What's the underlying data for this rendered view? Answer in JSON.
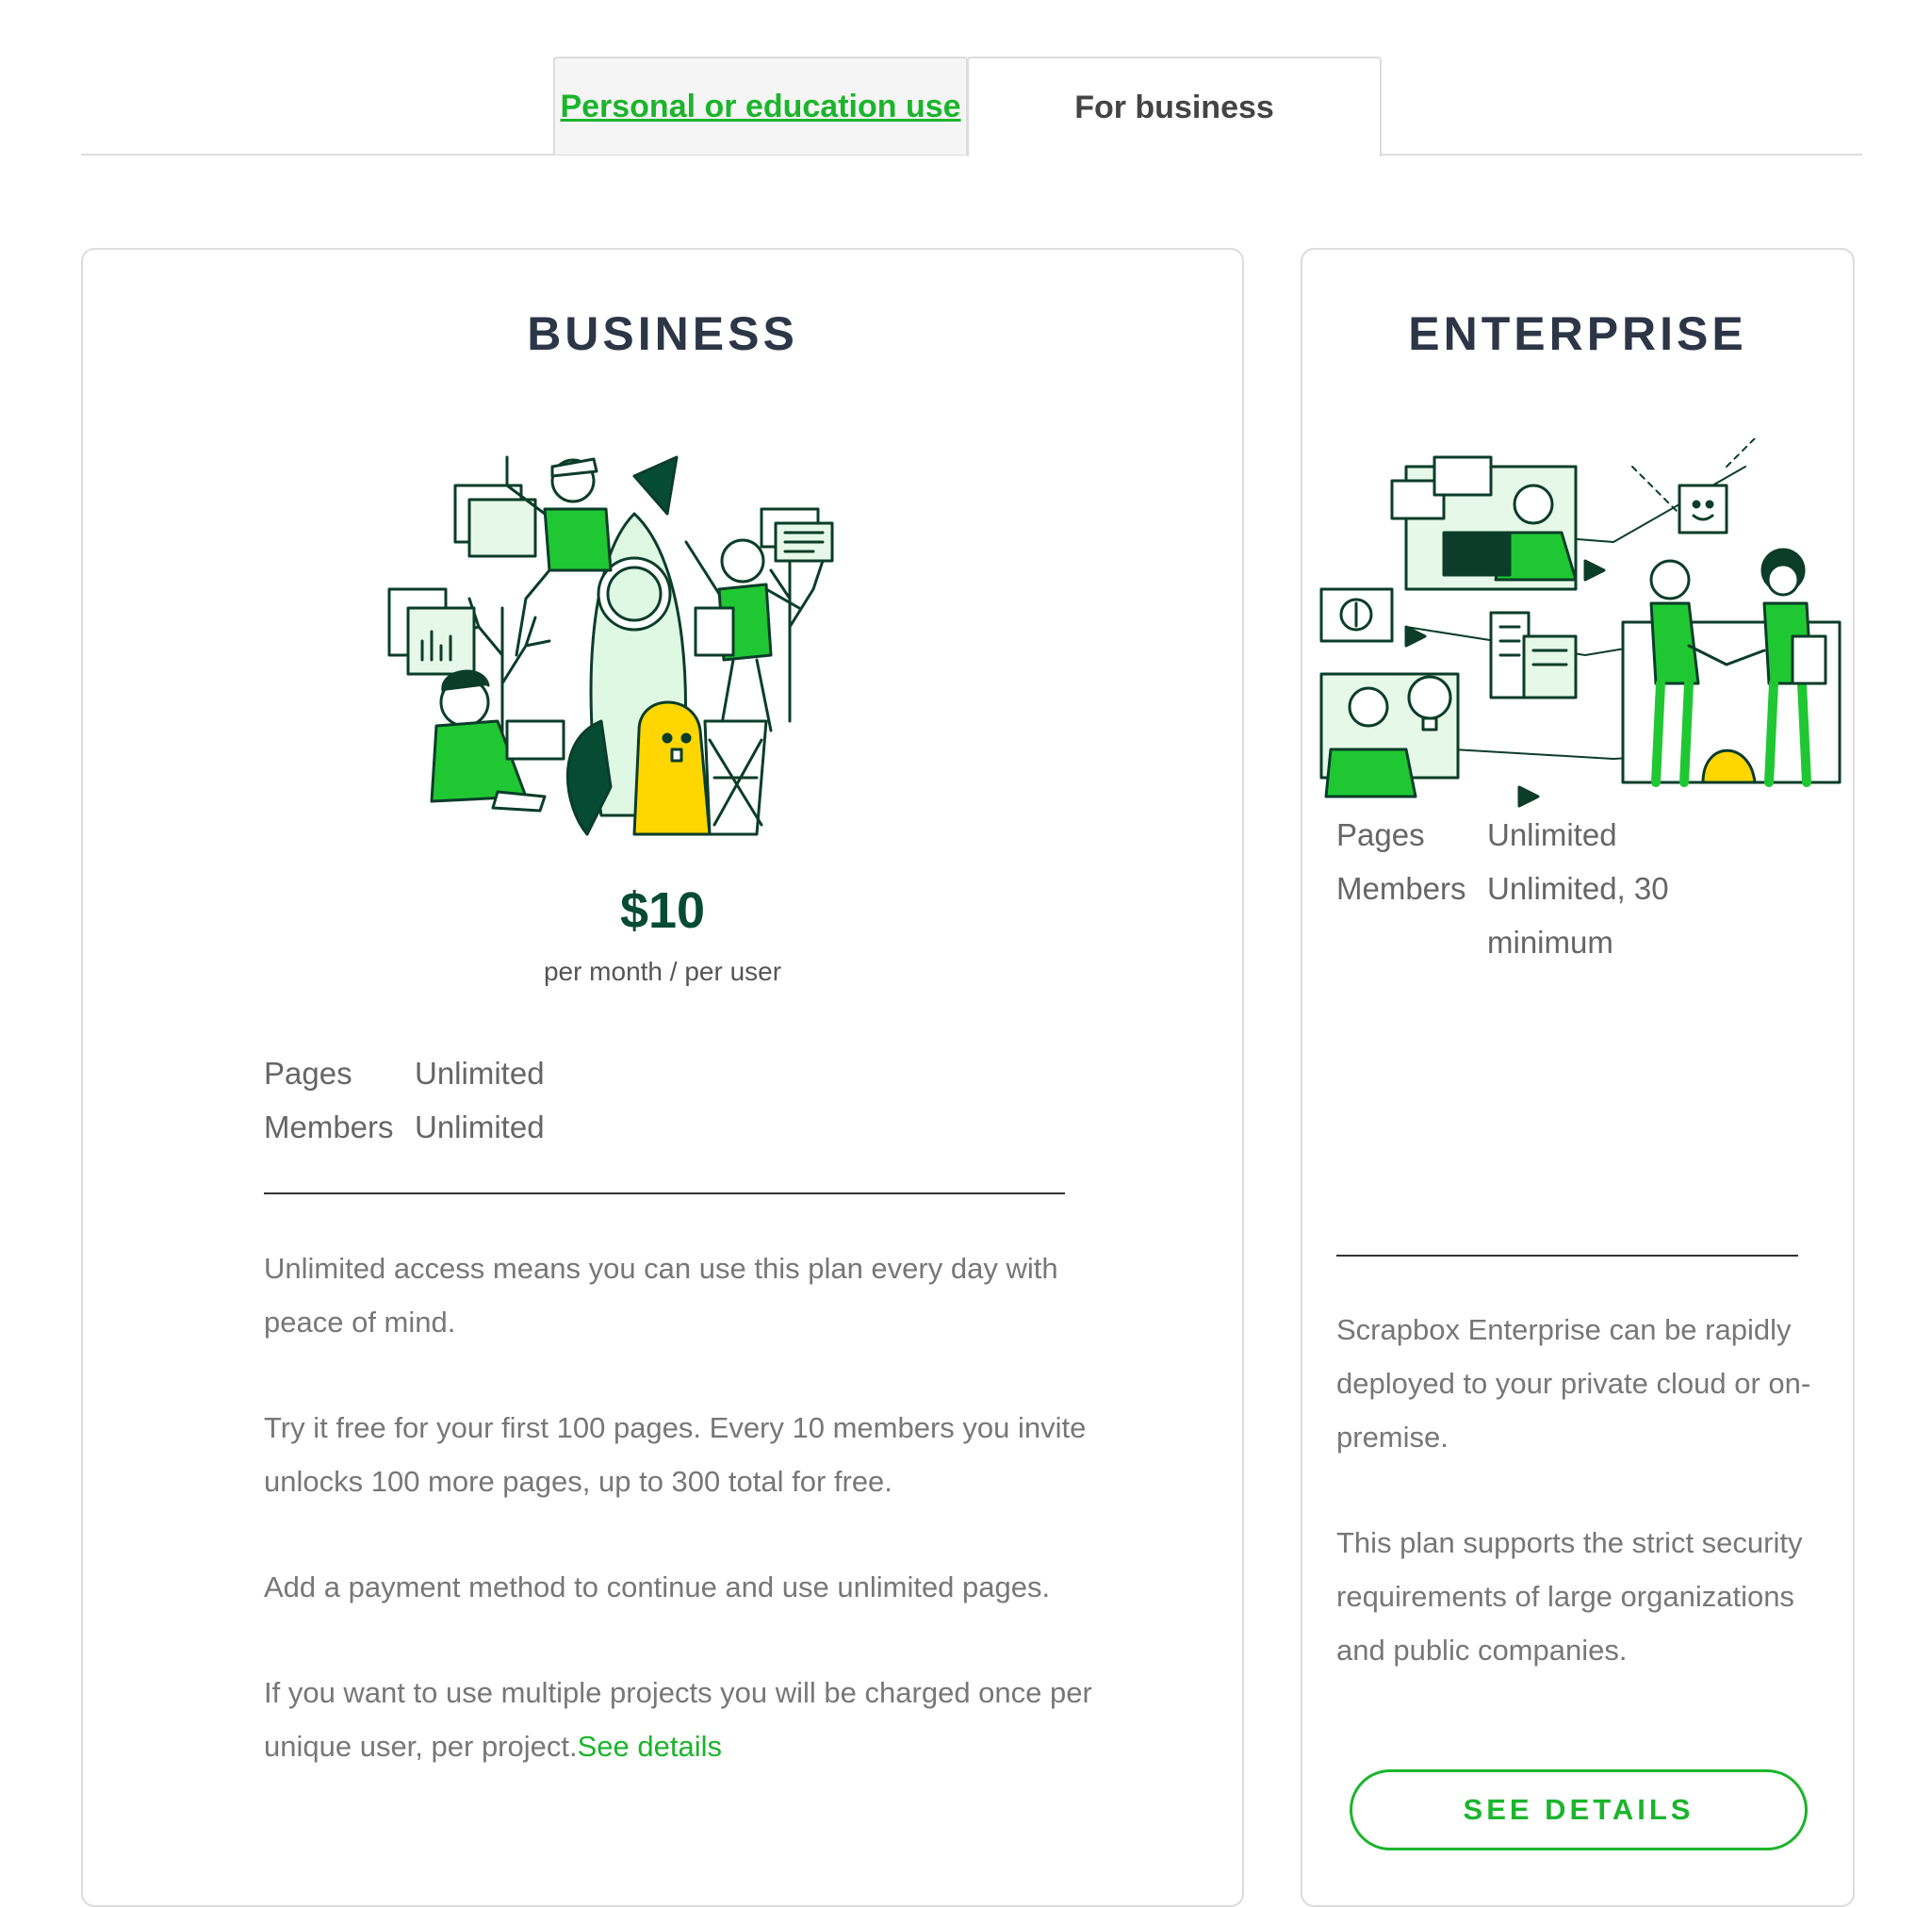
{
  "tabs": {
    "personal_label": "Personal or education use",
    "business_label": "For business"
  },
  "business": {
    "title": "BUSINESS",
    "price": "$10",
    "price_unit": "per month / per user",
    "specs": [
      {
        "key": "Pages",
        "value": "Unlimited"
      },
      {
        "key": "Members",
        "value": "Unlimited"
      }
    ],
    "paragraphs": [
      "Unlimited access means you can use this plan every day with peace of mind.",
      "Try it free for your first 100 pages. Every 10 members you invite unlocks 100 more pages, up to 300 total for free.",
      "Add a payment method to continue and use unlimited pages."
    ],
    "last_paragraph": "If you want to use multiple projects you will be charged once per unique user, per project.",
    "see_details_link": "See details"
  },
  "enterprise": {
    "title": "ENTERPRISE",
    "specs": [
      {
        "key": "Pages",
        "value": "Unlimited"
      },
      {
        "key": "Members",
        "value": "Unlimited, 30 minimum"
      }
    ],
    "paragraphs": [
      "Scrapbox Enterprise can be rapidly deployed to your private cloud or on-premise.",
      "This plan supports the strict security requirements of large organizations and public companies."
    ],
    "button_label": "SEE DETAILS"
  },
  "colors": {
    "brand_green": "#1bb52b",
    "dark_green": "#064c34",
    "title_navy": "#2d3646"
  },
  "icons": [
    "rocket-team-illustration",
    "enterprise-handshake-illustration"
  ]
}
